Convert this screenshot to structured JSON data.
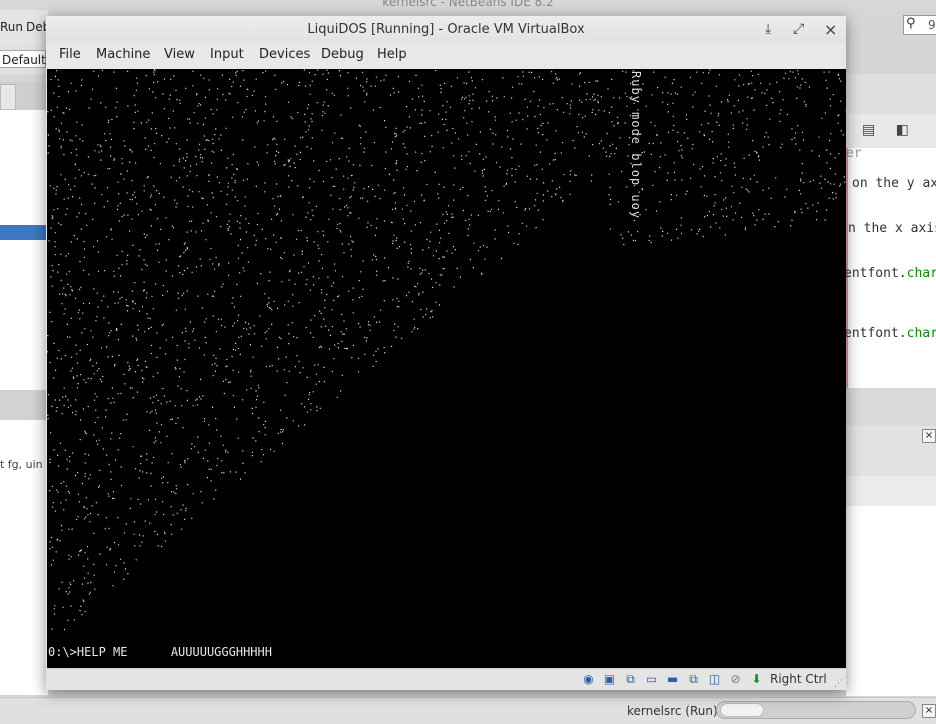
{
  "ide": {
    "window_title": "kernelsrc - NetBeans IDE 8.2",
    "menu_run": "Run",
    "menu_debug_partial": "Deb",
    "config_value": "Default",
    "search_text": "9",
    "left_snippet": "t fg, uin",
    "code_lines": [
      {
        "text": "er",
        "kind": "gray"
      },
      {
        "text": "on the y ax",
        "kind": "plain"
      },
      {
        "text": "n the x axis",
        "kind": "plain"
      },
      {
        "prefix": "entfont.",
        "suffix": "char",
        "kind": "mixed"
      },
      {
        "prefix": "entfont.",
        "suffix": "char",
        "kind": "mixed"
      }
    ],
    "status_text": "kernelsrc (Run)",
    "close_glyph": "×"
  },
  "vbox": {
    "title": "LiquiDOS [Running] - Oracle VM VirtualBox",
    "ctrl_minimize": "⤓",
    "ctrl_maximize": "⤢",
    "ctrl_close": "×",
    "menu": [
      "File",
      "Machine",
      "View",
      "Input",
      "Devices",
      "Debug",
      "Help"
    ],
    "screen": {
      "vertical_text": "Ruby mode blop uoy",
      "terminal_line": "0:\\>HELP ME      AUUUUUGGGHHHHH"
    },
    "status_icons": [
      {
        "name": "optical-drive-icon",
        "glyph": "◉"
      },
      {
        "name": "floppy-icon",
        "glyph": "▣"
      },
      {
        "name": "network-icon",
        "glyph": "⧉"
      },
      {
        "name": "shared-folder-icon",
        "glyph": "▭"
      },
      {
        "name": "display-icon",
        "glyph": "▬"
      },
      {
        "name": "video-capture-icon",
        "glyph": "⧉"
      },
      {
        "name": "usb-icon",
        "glyph": "◫"
      },
      {
        "name": "mouse-integration-icon",
        "glyph": "⊘"
      },
      {
        "name": "keyboard-capture-icon",
        "glyph": "⬇"
      }
    ],
    "host_key": "Right Ctrl"
  }
}
